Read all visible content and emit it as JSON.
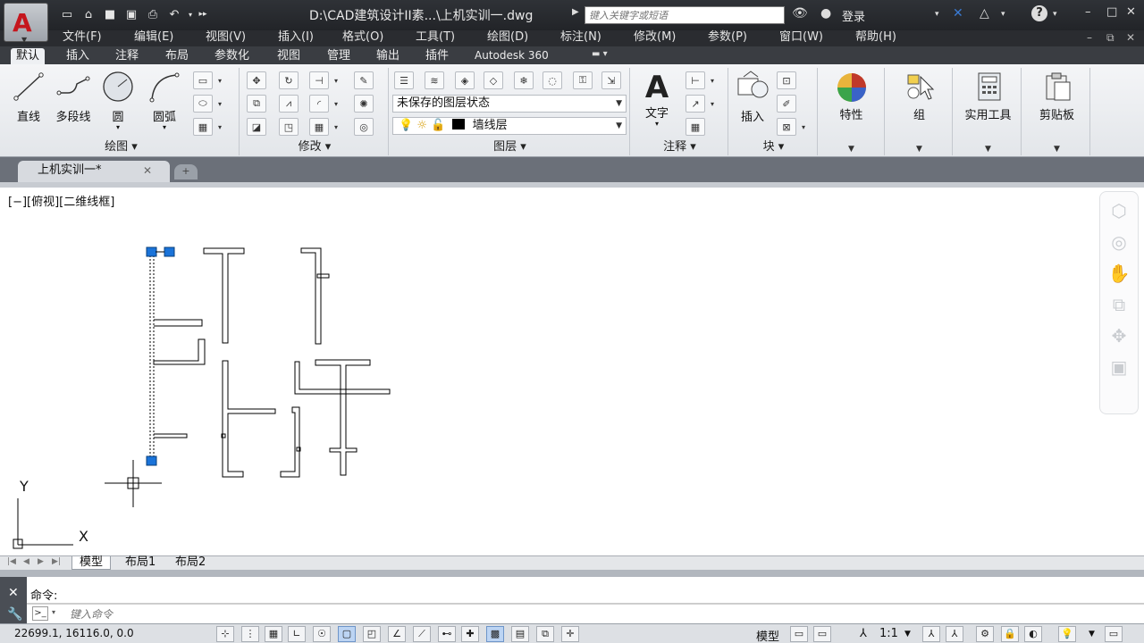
{
  "titlebar": {
    "logo_letter": "A",
    "document_title": "D:\\CAD建筑设计II素...\\上机实训一.dwg",
    "search_placeholder": "键入关键字或短语",
    "login_label": "登录",
    "help_glyph": "?"
  },
  "menu": [
    "文件(F)",
    "编辑(E)",
    "视图(V)",
    "插入(I)",
    "格式(O)",
    "工具(T)",
    "绘图(D)",
    "标注(N)",
    "修改(M)",
    "参数(P)",
    "窗口(W)",
    "帮助(H)"
  ],
  "ribbon_tabs": [
    "默认",
    "插入",
    "注释",
    "布局",
    "参数化",
    "视图",
    "管理",
    "输出",
    "插件",
    "Autodesk 360"
  ],
  "draw_panel": {
    "title": "绘图",
    "tools": [
      "直线",
      "多段线",
      "圆",
      "圆弧"
    ]
  },
  "modify_panel": {
    "title": "修改"
  },
  "layer_panel": {
    "title": "图层",
    "state_value": "未保存的图层状态",
    "current_layer": "墙线层"
  },
  "annotation_panel": {
    "title": "注释",
    "tool": "文字",
    "big_glyph": "A"
  },
  "block_panel": {
    "title": "块",
    "tool": "插入"
  },
  "big_panels": [
    "特性",
    "组",
    "实用工具",
    "剪贴板"
  ],
  "doc_tab": {
    "label": "上机实训一*"
  },
  "viewport_label": "[−][俯视][二维线框]",
  "ucs": {
    "x_label": "X",
    "y_label": "Y"
  },
  "layout_tabs": [
    "模型",
    "布局1",
    "布局2"
  ],
  "command": {
    "history_label": "命令:",
    "input_placeholder": "键入命令"
  },
  "statusbar": {
    "coords": "22699.1, 16116.0, 0.0",
    "model_label": "模型",
    "scale_label": "1:1"
  },
  "colors": {
    "accent_selection": "#1a73d9",
    "logo_red": "#c5161d",
    "title_bg": "#2a2c30"
  }
}
